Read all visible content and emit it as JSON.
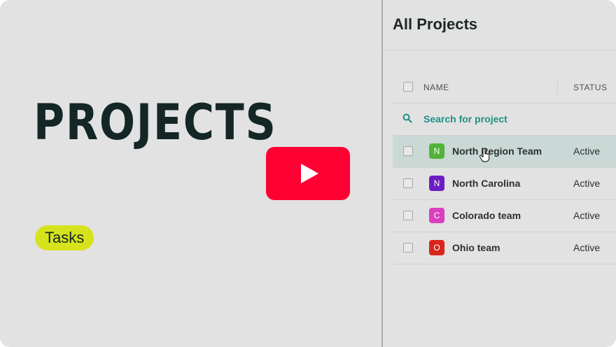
{
  "hero": {
    "title": "PROJECTS",
    "tag": "Tasks"
  },
  "panel": {
    "title": "All Projects",
    "columns": {
      "name": "NAME",
      "status": "STATUS"
    },
    "search_label": "Search for project",
    "projects": [
      {
        "initial": "N",
        "name": "North Region Team",
        "status": "Active",
        "color": "#52b33a",
        "selected": true
      },
      {
        "initial": "N",
        "name": "North Carolina",
        "status": "Active",
        "color": "#6a1ec3",
        "selected": false
      },
      {
        "initial": "C",
        "name": "Colorado team",
        "status": "Active",
        "color": "#d93fbf",
        "selected": false
      },
      {
        "initial": "O",
        "name": "Ohio team",
        "status": "Active",
        "color": "#d9261c",
        "selected": false
      }
    ]
  },
  "colors": {
    "accent": "#1f8f86",
    "play": "#ff0033",
    "tag": "#d6e31c"
  },
  "icons": {
    "play": "play-icon",
    "search": "search-icon",
    "cursor": "pointer-cursor-icon"
  }
}
